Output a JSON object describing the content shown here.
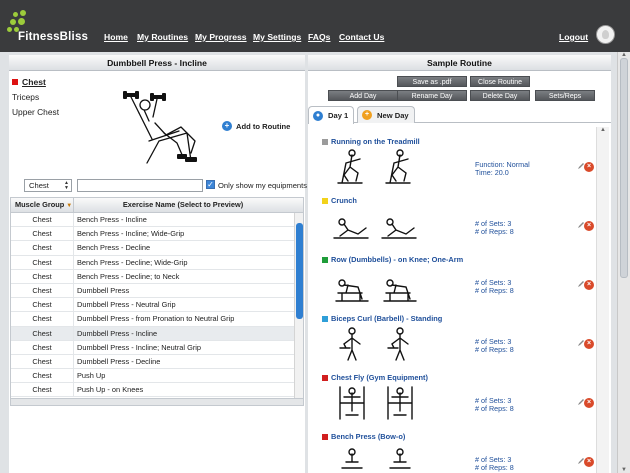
{
  "header": {
    "logo_text": "FitnessBliss",
    "nav": [
      "Home",
      "My Routines",
      "My Progress",
      "My Settings",
      "FAQs",
      "Contact Us"
    ],
    "logout": "Logout"
  },
  "left_panel": {
    "title": "Dumbbell Press - Incline",
    "target_primary": "Chest",
    "target_secondary": [
      "Triceps",
      "Upper Chest"
    ],
    "add_to_routine": "Add to Routine",
    "muscle_filter": "Chest",
    "search_value": "",
    "only_equipment_label": "Only show my equipments",
    "only_equipment_checked": true,
    "table": {
      "headers": [
        "Muscle Group",
        "Exercise Name (Select to Preview)"
      ],
      "rows": [
        [
          "Chest",
          "Bench Press - Incline"
        ],
        [
          "Chest",
          "Bench Press - Incline; Wide-Grip"
        ],
        [
          "Chest",
          "Bench Press - Decline"
        ],
        [
          "Chest",
          "Bench Press - Decline; Wide-Grip"
        ],
        [
          "Chest",
          "Bench Press - Decline; to Neck"
        ],
        [
          "Chest",
          "Dumbbell Press"
        ],
        [
          "Chest",
          "Dumbbell Press - Neutral Grip"
        ],
        [
          "Chest",
          "Dumbbell Press - from Pronation to Neutral Grip"
        ],
        [
          "Chest",
          "Dumbbell Press - Incline"
        ],
        [
          "Chest",
          "Dumbbell Press - Incline; Neutral Grip"
        ],
        [
          "Chest",
          "Dumbbell Press - Decline"
        ],
        [
          "Chest",
          "Push Up"
        ],
        [
          "Chest",
          "Push Up - on Knees"
        ]
      ],
      "selected_index": 8
    }
  },
  "right_panel": {
    "title": "Sample Routine",
    "buttons_row1": [
      "Save as .pdf",
      "Close Routine"
    ],
    "buttons_row2": [
      "Add Day",
      "Rename Day",
      "Delete Day",
      "Sets/Reps"
    ],
    "tabs": [
      "Day 1",
      "New Day"
    ],
    "entries": [
      {
        "name": "Running on the Treadmill",
        "color": "#9b9b9b",
        "line1": "Function: Normal",
        "line2": "Time: 20.0"
      },
      {
        "name": "Crunch",
        "color": "#f2d21b",
        "line1": "# of Sets: 3",
        "line2": "# of Reps: 8"
      },
      {
        "name": "Row (Dumbbells) - on Knee; One-Arm",
        "color": "#1f9d3a",
        "line1": "# of Sets: 3",
        "line2": "# of Reps: 8"
      },
      {
        "name": "Biceps Curl (Barbell) - Standing",
        "color": "#2f9fd8",
        "line1": "# of Sets: 3",
        "line2": "# of Reps: 8"
      },
      {
        "name": "Chest Fly (Gym Equipment)",
        "color": "#d11f1f",
        "line1": "# of Sets: 3",
        "line2": "# of Reps: 8"
      },
      {
        "name": "Bench Press (Bow-o)",
        "color": "#d11f1f",
        "line1": "# of Sets: 3",
        "line2": "# of Reps: 8"
      }
    ]
  }
}
